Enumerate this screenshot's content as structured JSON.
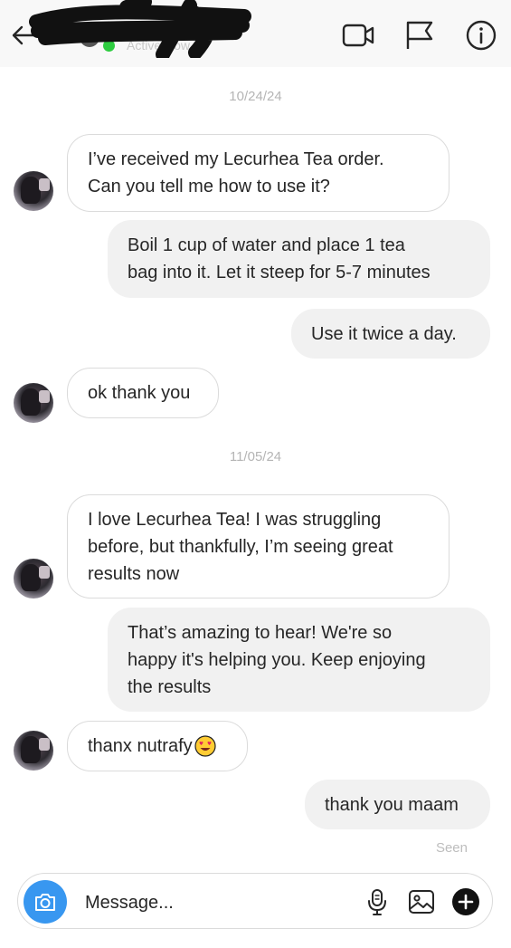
{
  "header": {
    "status": "Active Now",
    "icons": [
      "back-arrow-icon",
      "video-call-icon",
      "flag-icon",
      "info-icon"
    ]
  },
  "messages": {
    "date_1": "10/24/24",
    "m1": "I’ve received my Lecurhea Tea order.\nCan you tell me how to use it?",
    "m2": "Boil 1 cup of water and place 1 tea\nbag into it. Let it steep for 5-7 minutes",
    "m3": "Use it twice a day.",
    "m4": "ok thank you",
    "date_2": "11/05/24",
    "m5": "I love Lecurhea Tea! I was struggling\nbefore, but thankfully, I’m seeing great\nresults now",
    "m6": "That’s amazing to hear! We're so\nhappy it's helping you. Keep enjoying\nthe results",
    "m7": "thanx nutrafy",
    "m8": "thank you maam",
    "seen": "Seen"
  },
  "composer": {
    "placeholder": "Message...",
    "icons": [
      "camera-icon",
      "microphone-icon",
      "image-icon",
      "plus-icon"
    ]
  },
  "colors": {
    "accent": "#3897f0",
    "online": "#2ecc40",
    "outgoing_bubble": "#f1f1f1",
    "incoming_border": "#dbdbdb"
  }
}
